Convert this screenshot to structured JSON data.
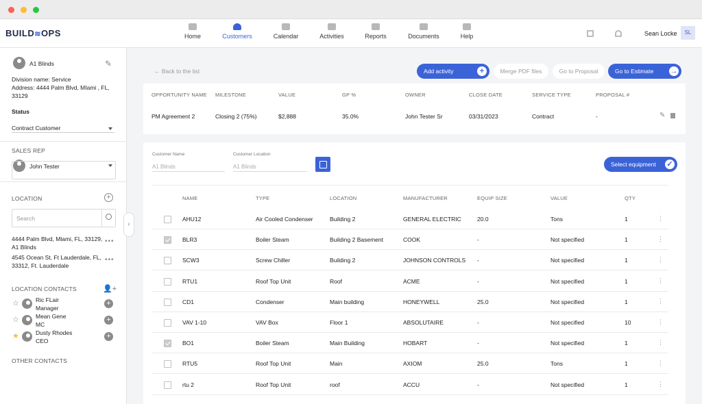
{
  "brand": {
    "logo_left": "BUILD",
    "logo_right": "OPS"
  },
  "nav": [
    {
      "label": "Home"
    },
    {
      "label": "Customers"
    },
    {
      "label": "Calendar"
    },
    {
      "label": "Activities"
    },
    {
      "label": "Reports"
    },
    {
      "label": "Documents"
    },
    {
      "label": "Help"
    }
  ],
  "user": {
    "name": "Sean Locke",
    "initials": "SL"
  },
  "customer": {
    "name": "A1 Blinds",
    "division": "Division name: Service",
    "address_line1": "Address: 4444 Palm Blvd, MIami , FL,",
    "address_line2": "33129",
    "status_label": "Status",
    "status_value": "Contract Customer",
    "sales_rep_label": "SALES REP",
    "sales_rep": "John Tester"
  },
  "location": {
    "label": "LOCATION",
    "search_placeholder": "Search",
    "items": [
      {
        "line1": "4444 Palm Blvd, Mlami, FL, 33129,",
        "line2": "A1 Blinds"
      },
      {
        "line1": "4545 Ocean St, Ft Lauderdale, FL,",
        "line2": "33312, Ft. Lauderdale"
      }
    ]
  },
  "contacts": {
    "label": "LOCATION CONTACTS",
    "items": [
      {
        "name": "Ric FLair",
        "role": "Manager",
        "starred": false
      },
      {
        "name": "Mean Gene",
        "role": "MC",
        "starred": false
      },
      {
        "name": "Dusty Rhodes",
        "role": "CEO",
        "starred": true
      }
    ]
  },
  "other_contacts_label": "OTHER CONTACTS",
  "actions": {
    "back": "← Back to the list",
    "add_activity": "Add activity",
    "merge_pdf": "Merge PDF files",
    "go_proposal": "Go to Proposal",
    "go_estimate": "Go to Estimate"
  },
  "opportunity": {
    "headers": [
      "OPPORTUNITY NAME",
      "MILESTONE",
      "VALUE",
      "GP %",
      "OWNER",
      "CLOSE DATE",
      "SERVICE TYPE",
      "PROPOSAL #"
    ],
    "row": [
      "PM Agreement 2",
      "Closing 2 (75%)",
      "$2,888",
      "35.0%",
      "John Tester Sr",
      "03/31/2023",
      "Contract",
      "-"
    ]
  },
  "equipment": {
    "customer_name_label": "Customer Name",
    "customer_name_value": "A1 Blinds",
    "customer_location_label": "Customer Location",
    "customer_location_value": "A1 Blinds",
    "select_button": "Select equipment",
    "headers": [
      "NAME",
      "TYPE",
      "LOCATION",
      "MANUFACTURER",
      "EQUIP SIZE",
      "VALUE",
      "QTY"
    ],
    "rows": [
      {
        "checked": false,
        "cells": [
          "AHU12",
          "Air Cooled Condenser",
          "Building 2",
          "GENERAL ELECTRIC",
          "20.0",
          "Tons",
          "1"
        ]
      },
      {
        "checked": true,
        "cells": [
          "BLR3",
          "Boiler Steam",
          "Building 2 Basement",
          "COOK",
          "-",
          "Not specified",
          "1"
        ]
      },
      {
        "checked": false,
        "cells": [
          "SCW3",
          "Screw Chiller",
          "Building 2",
          "JOHNSON CONTROLS",
          "-",
          "Not specified",
          "1"
        ]
      },
      {
        "checked": false,
        "cells": [
          "RTU1",
          "Roof Top Unit",
          "Roof",
          "ACME",
          "-",
          "Not specified",
          "1"
        ]
      },
      {
        "checked": false,
        "cells": [
          "CD1",
          "Condenser",
          "Main building",
          "HONEYWELL",
          "25.0",
          "Not specified",
          "1"
        ]
      },
      {
        "checked": false,
        "cells": [
          "VAV 1-10",
          "VAV Box",
          "Floor 1",
          "ABSOLUTAIRE",
          "-",
          "Not specified",
          "10"
        ]
      },
      {
        "checked": true,
        "cells": [
          "BO1",
          "Boiler Steam",
          "Main Building",
          "HOBART",
          "-",
          "Not specified",
          "1"
        ]
      },
      {
        "checked": false,
        "cells": [
          "RTU5",
          "Roof Top Unit",
          "Main",
          "AXIOM",
          "25.0",
          "Tons",
          "1"
        ]
      },
      {
        "checked": false,
        "cells": [
          "rtu 2",
          "Roof Top Unit",
          "roof",
          "ACCU",
          "-",
          "Not specified",
          "1"
        ]
      }
    ]
  },
  "colors": {
    "accent": "#3b63d8",
    "star_active": "#f2c232"
  }
}
